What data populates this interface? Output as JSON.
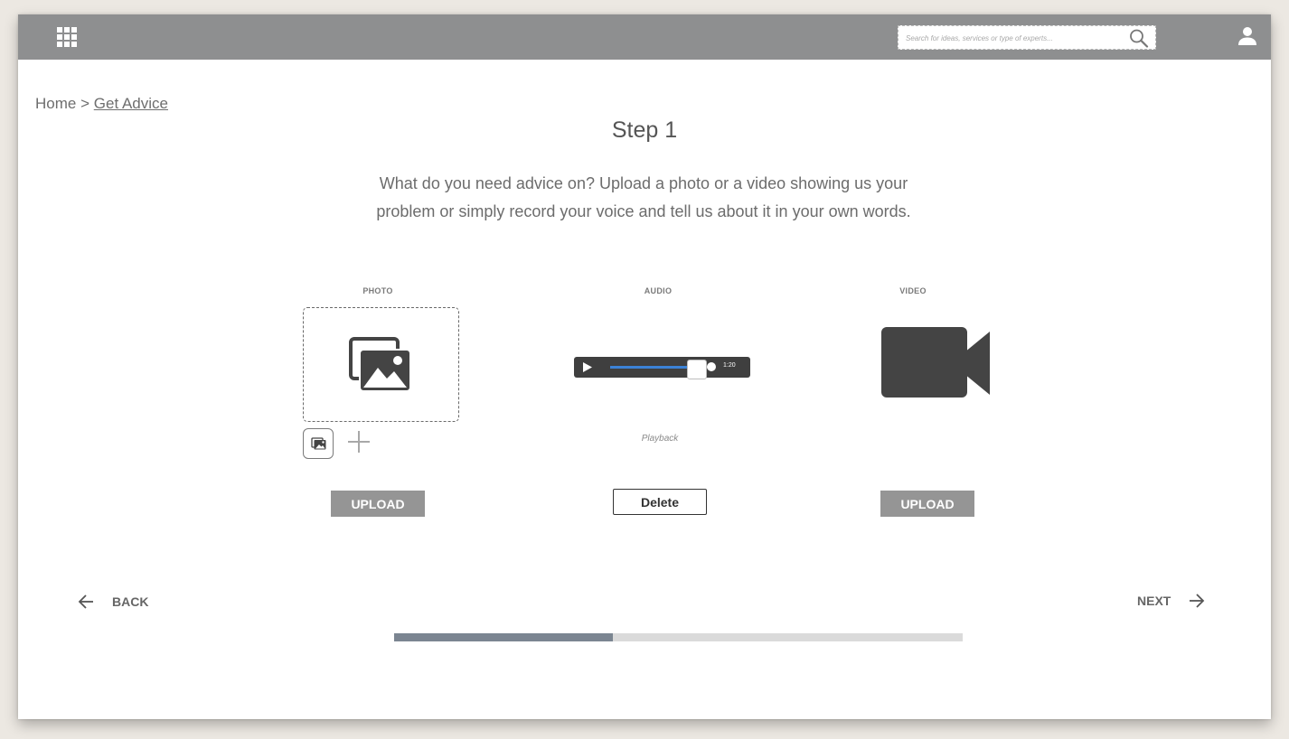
{
  "header": {
    "search_placeholder": "Search for ideas, services or type of experts..."
  },
  "breadcrumb": {
    "home": "Home",
    "separator": ">",
    "current": "Get Advice"
  },
  "page": {
    "title": "Step 1",
    "instructions_line1": "What do you need advice on? Upload a photo or a video showing us your",
    "instructions_line2": "problem or simply record your voice and tell us about it in your own words."
  },
  "photo": {
    "label": "PHOTO",
    "upload_label": "UPLOAD"
  },
  "audio": {
    "label": "AUDIO",
    "time": "1:20",
    "volume_fraction": 0.86,
    "caption": "Playback",
    "delete_label": "Delete"
  },
  "video": {
    "label": "VIDEO",
    "upload_label": "UPLOAD"
  },
  "nav": {
    "back_label": "BACK",
    "next_label": "NEXT"
  },
  "progress": {
    "fraction": 0.385
  },
  "colors": {
    "header_bg": "#8e8f90",
    "button_bg": "#959595",
    "audio_accent": "#3b82d6",
    "progress_fill": "#7b8591",
    "progress_track": "#dadada"
  }
}
